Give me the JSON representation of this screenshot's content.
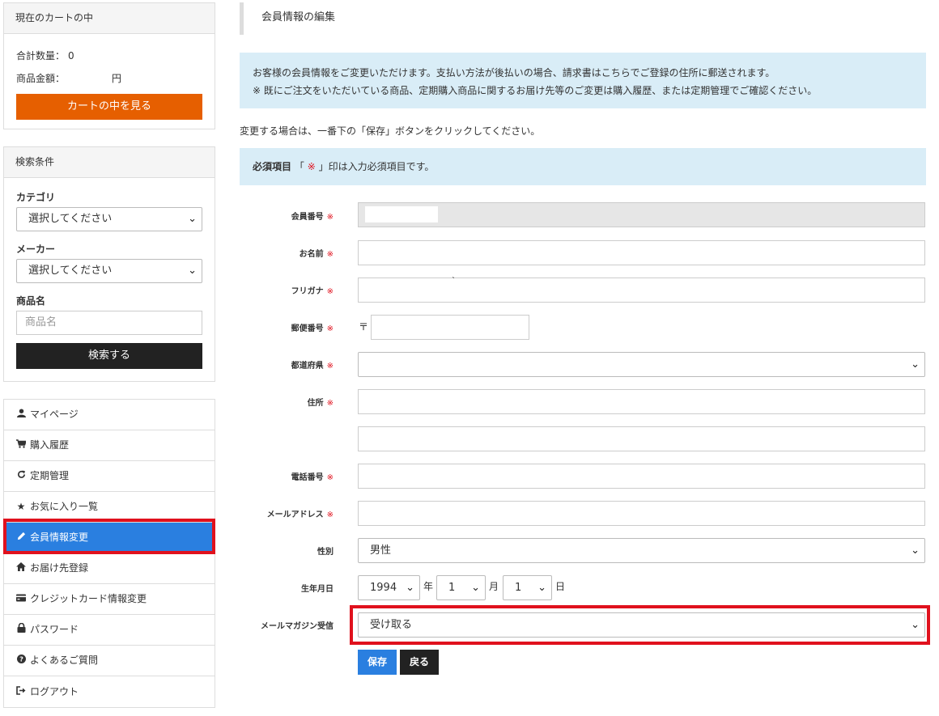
{
  "cart": {
    "title": "現在のカートの中",
    "quantity_label": "合計数量：",
    "quantity_value": "0",
    "amount_label": "商品金額：",
    "amount_unit": "円",
    "view_cart_label": "カートの中を見る"
  },
  "search": {
    "title": "検索条件",
    "category_label": "カテゴリ",
    "category_value": "選択してください",
    "maker_label": "メーカー",
    "maker_value": "選択してください",
    "product_label": "商品名",
    "product_placeholder": "商品名",
    "search_button": "検索する"
  },
  "menu": {
    "items": [
      {
        "label": "マイページ",
        "icon": "user-icon"
      },
      {
        "label": "購入履歴",
        "icon": "cart-icon"
      },
      {
        "label": "定期管理",
        "icon": "refresh-icon"
      },
      {
        "label": "お気に入り一覧",
        "icon": "star-icon"
      },
      {
        "label": "会員情報変更",
        "icon": "pencil-icon"
      },
      {
        "label": "お届け先登録",
        "icon": "home-icon"
      },
      {
        "label": "クレジットカード情報変更",
        "icon": "credit-card-icon"
      },
      {
        "label": "パスワード",
        "icon": "lock-icon"
      },
      {
        "label": "よくあるご質問",
        "icon": "question-icon"
      },
      {
        "label": "ログアウト",
        "icon": "logout-icon"
      }
    ],
    "active_index": 4
  },
  "main": {
    "title": "会員情報の編集",
    "info_line1": "お客様の会員情報をご変更いただけます。支払い方法が後払いの場合、請求書はこちらでご登録の住所に郵送されます。",
    "info_line2": "※ 既にご注文をいただいている商品、定期購入商品に関するお届け先等のご変更は購入履歴、または定期管理でご確認ください。",
    "note": "変更する場合は、一番下の「保存」ボタンをクリックしてください。",
    "required_title": "必須項目",
    "required_open": "「",
    "required_mark": "※",
    "required_close": "」印は入力必須項目です。"
  },
  "form": {
    "required_mark": "※",
    "member_no_label": "会員番号",
    "name_label": "お名前",
    "furigana_label": "フリガナ",
    "furigana_value": "`",
    "postal_label": "郵便番号",
    "postal_prefix": "〒",
    "prefecture_label": "都道府県",
    "prefecture_value": "",
    "address_label": "住所",
    "phone_label": "電話番号",
    "email_label": "メールアドレス",
    "gender_label": "性別",
    "gender_value": "男性",
    "birthday_label": "生年月日",
    "birth_year": "1994",
    "year_unit": "年",
    "birth_month": "1",
    "month_unit": "月",
    "birth_day": "1",
    "day_unit": "日",
    "magazine_label": "メールマガジン受信",
    "magazine_value": "受け取る",
    "save_label": "保存",
    "back_label": "戻る"
  },
  "colors": {
    "accent_blue": "#2a7fe0",
    "cart_orange": "#e65f00",
    "highlight_red": "#e0111d",
    "info_bg": "#d9edf7"
  }
}
